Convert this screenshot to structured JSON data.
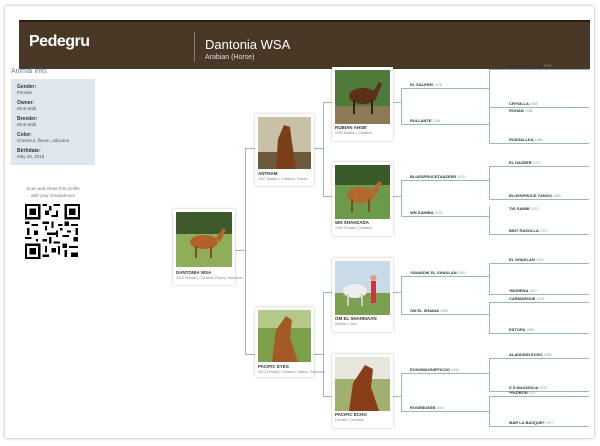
{
  "header": {
    "logo": "Pedegru",
    "horse_name": "Dantonia WSA",
    "breed": "Arabian (Horse)"
  },
  "info": {
    "title": "Animal Info.",
    "fields": [
      {
        "label": "Gender:",
        "value": "Female"
      },
      {
        "label": "Owner:",
        "value": "Dina Wild"
      },
      {
        "label": "Breeder:",
        "value": "Dina Wild"
      },
      {
        "label": "Color:",
        "value": "Chestnut, flaxen, rabicano"
      },
      {
        "label": "Birthdate:",
        "value": "May 25, 2018"
      }
    ],
    "qr_line1": "Scan and share this profile",
    "qr_line2": "with your smartphone!"
  },
  "subject": {
    "name": "DANTONIA WSA",
    "details": "2018 Female | Chestnut, Flaxen, Rabicano"
  },
  "parents": [
    {
      "name": "ANTHAM",
      "details": "2007 Stallion | Chestnut, Flaxen"
    },
    {
      "name": "PACIFIC EYES",
      "details": "2013 Female | Chestnut, Sabino, Rabicano"
    }
  ],
  "grandparents": [
    {
      "name": "RUBIAN AHSB",
      "details": "1999 Stallion | Chestnut"
    },
    {
      "name": "WN SHAHZADA",
      "details": "1996 Female | Chestnut"
    },
    {
      "name": "OM EL SHAHMAAN",
      "details": "Stallion | Grey"
    },
    {
      "name": "PACIFIC ECHO",
      "details": "Female | Chestnut"
    }
  ],
  "great_grandparents": [
    {
      "name": "EL SALEEM",
      "year": "1976"
    },
    {
      "name": "RULLANTE",
      "year": "1996"
    },
    {
      "name": "BLUESPRUCETANZEER",
      "year": "1976"
    },
    {
      "name": "WN SAMIRA",
      "year": "1976"
    },
    {
      "name": "*SANADIK EL SHAKLAN",
      "year": "1981"
    },
    {
      "name": "OM EL SHAINA",
      "year": "1986"
    },
    {
      "name": "ECHOMAGNIFFICOO",
      "year": "1996"
    },
    {
      "name": "ROSEBUSSB",
      "year": "1992"
    }
  ],
  "great_great_grandparents": [
    {
      "name": "MALEK EL KHEIL",
      "year": "1979"
    },
    {
      "name": "CRYSILLA",
      "year": "1968"
    },
    {
      "name": "ROHAN",
      "year": "1968"
    },
    {
      "name": "RUSSALLKA",
      "year": "1988"
    },
    {
      "name": "EL HAZEER",
      "year": "1976"
    },
    {
      "name": "BLUESPRUCE TANGO",
      "year": "1980"
    },
    {
      "name": "TIG SAMIR",
      "year": "1976"
    },
    {
      "name": "BINT RASOLLA",
      "year": "1970"
    },
    {
      "name": "EL SHAKLAN",
      "year": "1975"
    },
    {
      "name": "*MOHENA",
      "year": "1967"
    },
    {
      "name": "CARMARGUE",
      "year": "1976"
    },
    {
      "name": "ESTOPA",
      "year": "1969"
    },
    {
      "name": "ALADDINN ECHO",
      "year": "1985"
    },
    {
      "name": "S S MAGNOLIA",
      "year": "1979"
    },
    {
      "name": "*PADRON",
      "year": "1977"
    },
    {
      "name": "MAR LA BASQUE+",
      "year": "1977"
    }
  ],
  "colors": {
    "header_bg": "#4a3826",
    "info_bg": "#dfe7ee",
    "link": "#5b7fa6",
    "connector": "#9bb9b5"
  }
}
